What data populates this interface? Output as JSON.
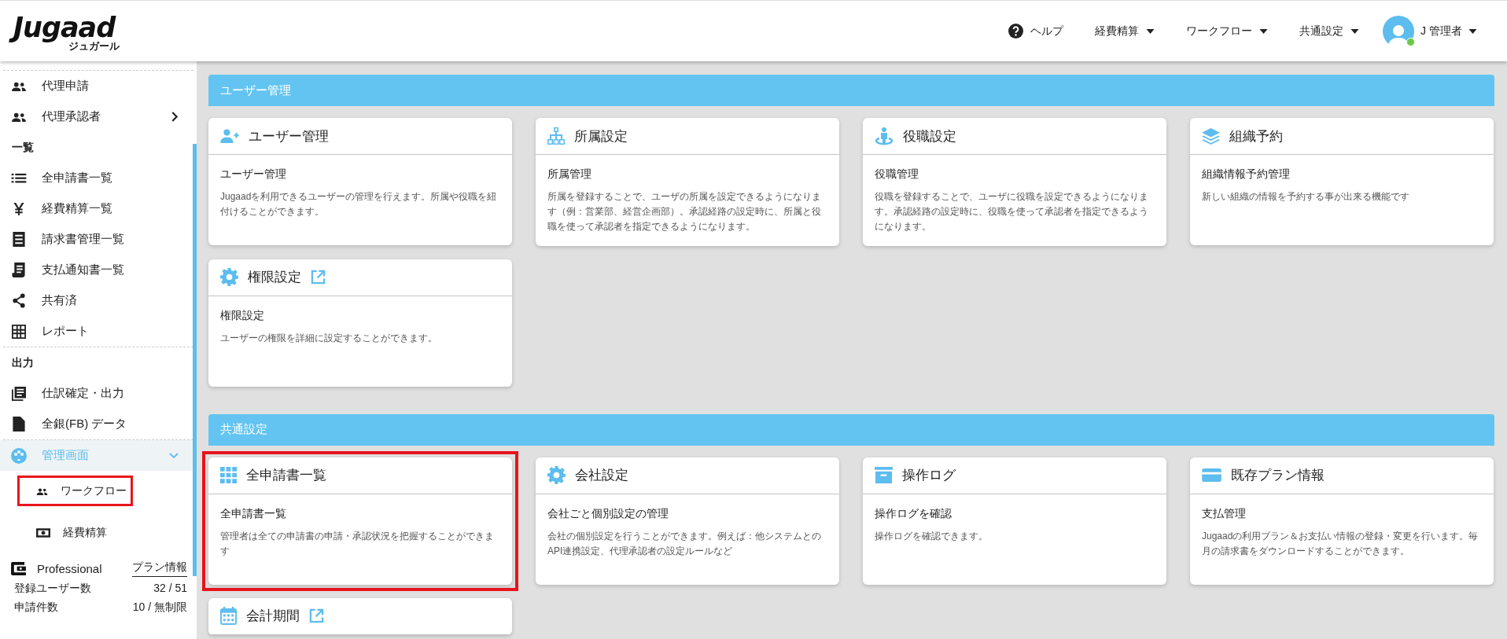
{
  "header": {
    "logo": {
      "text": "Jugaad",
      "subtext": "ジュガール"
    },
    "nav": [
      {
        "label": "ヘルプ",
        "kind": "help"
      },
      {
        "label": "経費精算",
        "kind": "dropdown"
      },
      {
        "label": "ワークフロー",
        "kind": "dropdown"
      },
      {
        "label": "共通設定",
        "kind": "dropdown"
      }
    ],
    "user": {
      "name": "J 管理者",
      "online": true
    }
  },
  "sidebar": {
    "items": [
      {
        "kind": "item",
        "label": "代理申請",
        "selected": false,
        "divider_above": true
      },
      {
        "kind": "submenu",
        "label": "代理承認者",
        "selected": false,
        "divider_above": false
      },
      {
        "kind": "heading",
        "label": "一覧",
        "divider_above": false
      },
      {
        "kind": "item",
        "label": "全申請書一覧",
        "selected": false,
        "divider_above": false
      },
      {
        "kind": "item",
        "label": "経費精算一覧",
        "selected": false,
        "divider_above": false
      },
      {
        "kind": "item",
        "label": "請求書管理一覧",
        "selected": false,
        "divider_above": false
      },
      {
        "kind": "item",
        "label": "支払通知書一覧",
        "selected": false,
        "divider_above": false
      },
      {
        "kind": "item",
        "label": "共有済",
        "selected": false,
        "divider_above": false
      },
      {
        "kind": "item",
        "label": "レポート",
        "selected": false,
        "divider_above": false
      },
      {
        "kind": "heading",
        "label": "出力",
        "divider_above": true
      },
      {
        "kind": "item",
        "label": "仕訳確定・出力",
        "selected": false,
        "divider_above": false
      },
      {
        "kind": "item",
        "label": "全銀(FB) データ",
        "selected": false,
        "divider_above": false
      },
      {
        "kind": "group",
        "label": "管理画面",
        "selected": true,
        "expanded": true,
        "divider_above": true,
        "children": [
          {
            "label": "ワークフロー",
            "selected": false,
            "highlighted": true
          },
          {
            "label": "経費精算",
            "selected": false,
            "highlighted": false
          }
        ]
      }
    ],
    "plan": {
      "name": "Professional",
      "link": "プラン情報",
      "stats": [
        {
          "label": "登録ユーザー数",
          "value": "32 / 51"
        },
        {
          "label": "申請件数",
          "value": "10 / 無制限"
        }
      ]
    }
  },
  "sections": [
    {
      "title": "ユーザー管理",
      "cards": [
        {
          "title": "ユーザー管理",
          "external": false,
          "highlighted": false,
          "subtitle": "ユーザー管理",
          "description": "Jugaadを利用できるユーザーの管理を行えます。所属や役職を紐付けることができます。"
        },
        {
          "title": "所属設定",
          "external": false,
          "highlighted": false,
          "subtitle": "所属管理",
          "description": "所属を登録することで、ユーザの所属を設定できるようになります（例：営業部、経営企画部）。承認経路の設定時に、所属と役職を使って承認者を指定できるようになります。"
        },
        {
          "title": "役職設定",
          "external": false,
          "highlighted": false,
          "subtitle": "役職管理",
          "description": "役職を登録することで、ユーザに役職を設定できるようになります。承認経路の設定時に、役職を使って承認者を指定できるようになります。"
        },
        {
          "title": "組織予約",
          "external": false,
          "highlighted": false,
          "subtitle": "組織情報予約管理",
          "description": "新しい組織の情報を予約する事が出来る機能です"
        },
        {
          "title": "権限設定",
          "external": true,
          "highlighted": false,
          "subtitle": "権限設定",
          "description": "ユーザーの権限を詳細に設定することができます。"
        }
      ]
    },
    {
      "title": "共通設定",
      "cards": [
        {
          "title": "全申請書一覧",
          "external": false,
          "highlighted": true,
          "subtitle": "全申請書一覧",
          "description": "管理者は全ての申請書の申請・承認状況を把握することができます"
        },
        {
          "title": "会社設定",
          "external": false,
          "highlighted": false,
          "subtitle": "会社ごと個別設定の管理",
          "description": "会社の個別設定を行うことができます。例えば：他システムとのAPI連携設定、代理承認者の設定ルールなど"
        },
        {
          "title": "操作ログ",
          "external": false,
          "highlighted": false,
          "subtitle": "操作ログを確認",
          "description": "操作ログを確認できます。"
        },
        {
          "title": "既存プラン情報",
          "external": false,
          "highlighted": false,
          "subtitle": "支払管理",
          "description": "Jugaadの利用プラン＆お支払い情報の登録・変更を行います。毎月の請求書をダウンロードすることができます。"
        },
        {
          "title": "会計期間",
          "external": true,
          "highlighted": false
        }
      ]
    }
  ]
}
